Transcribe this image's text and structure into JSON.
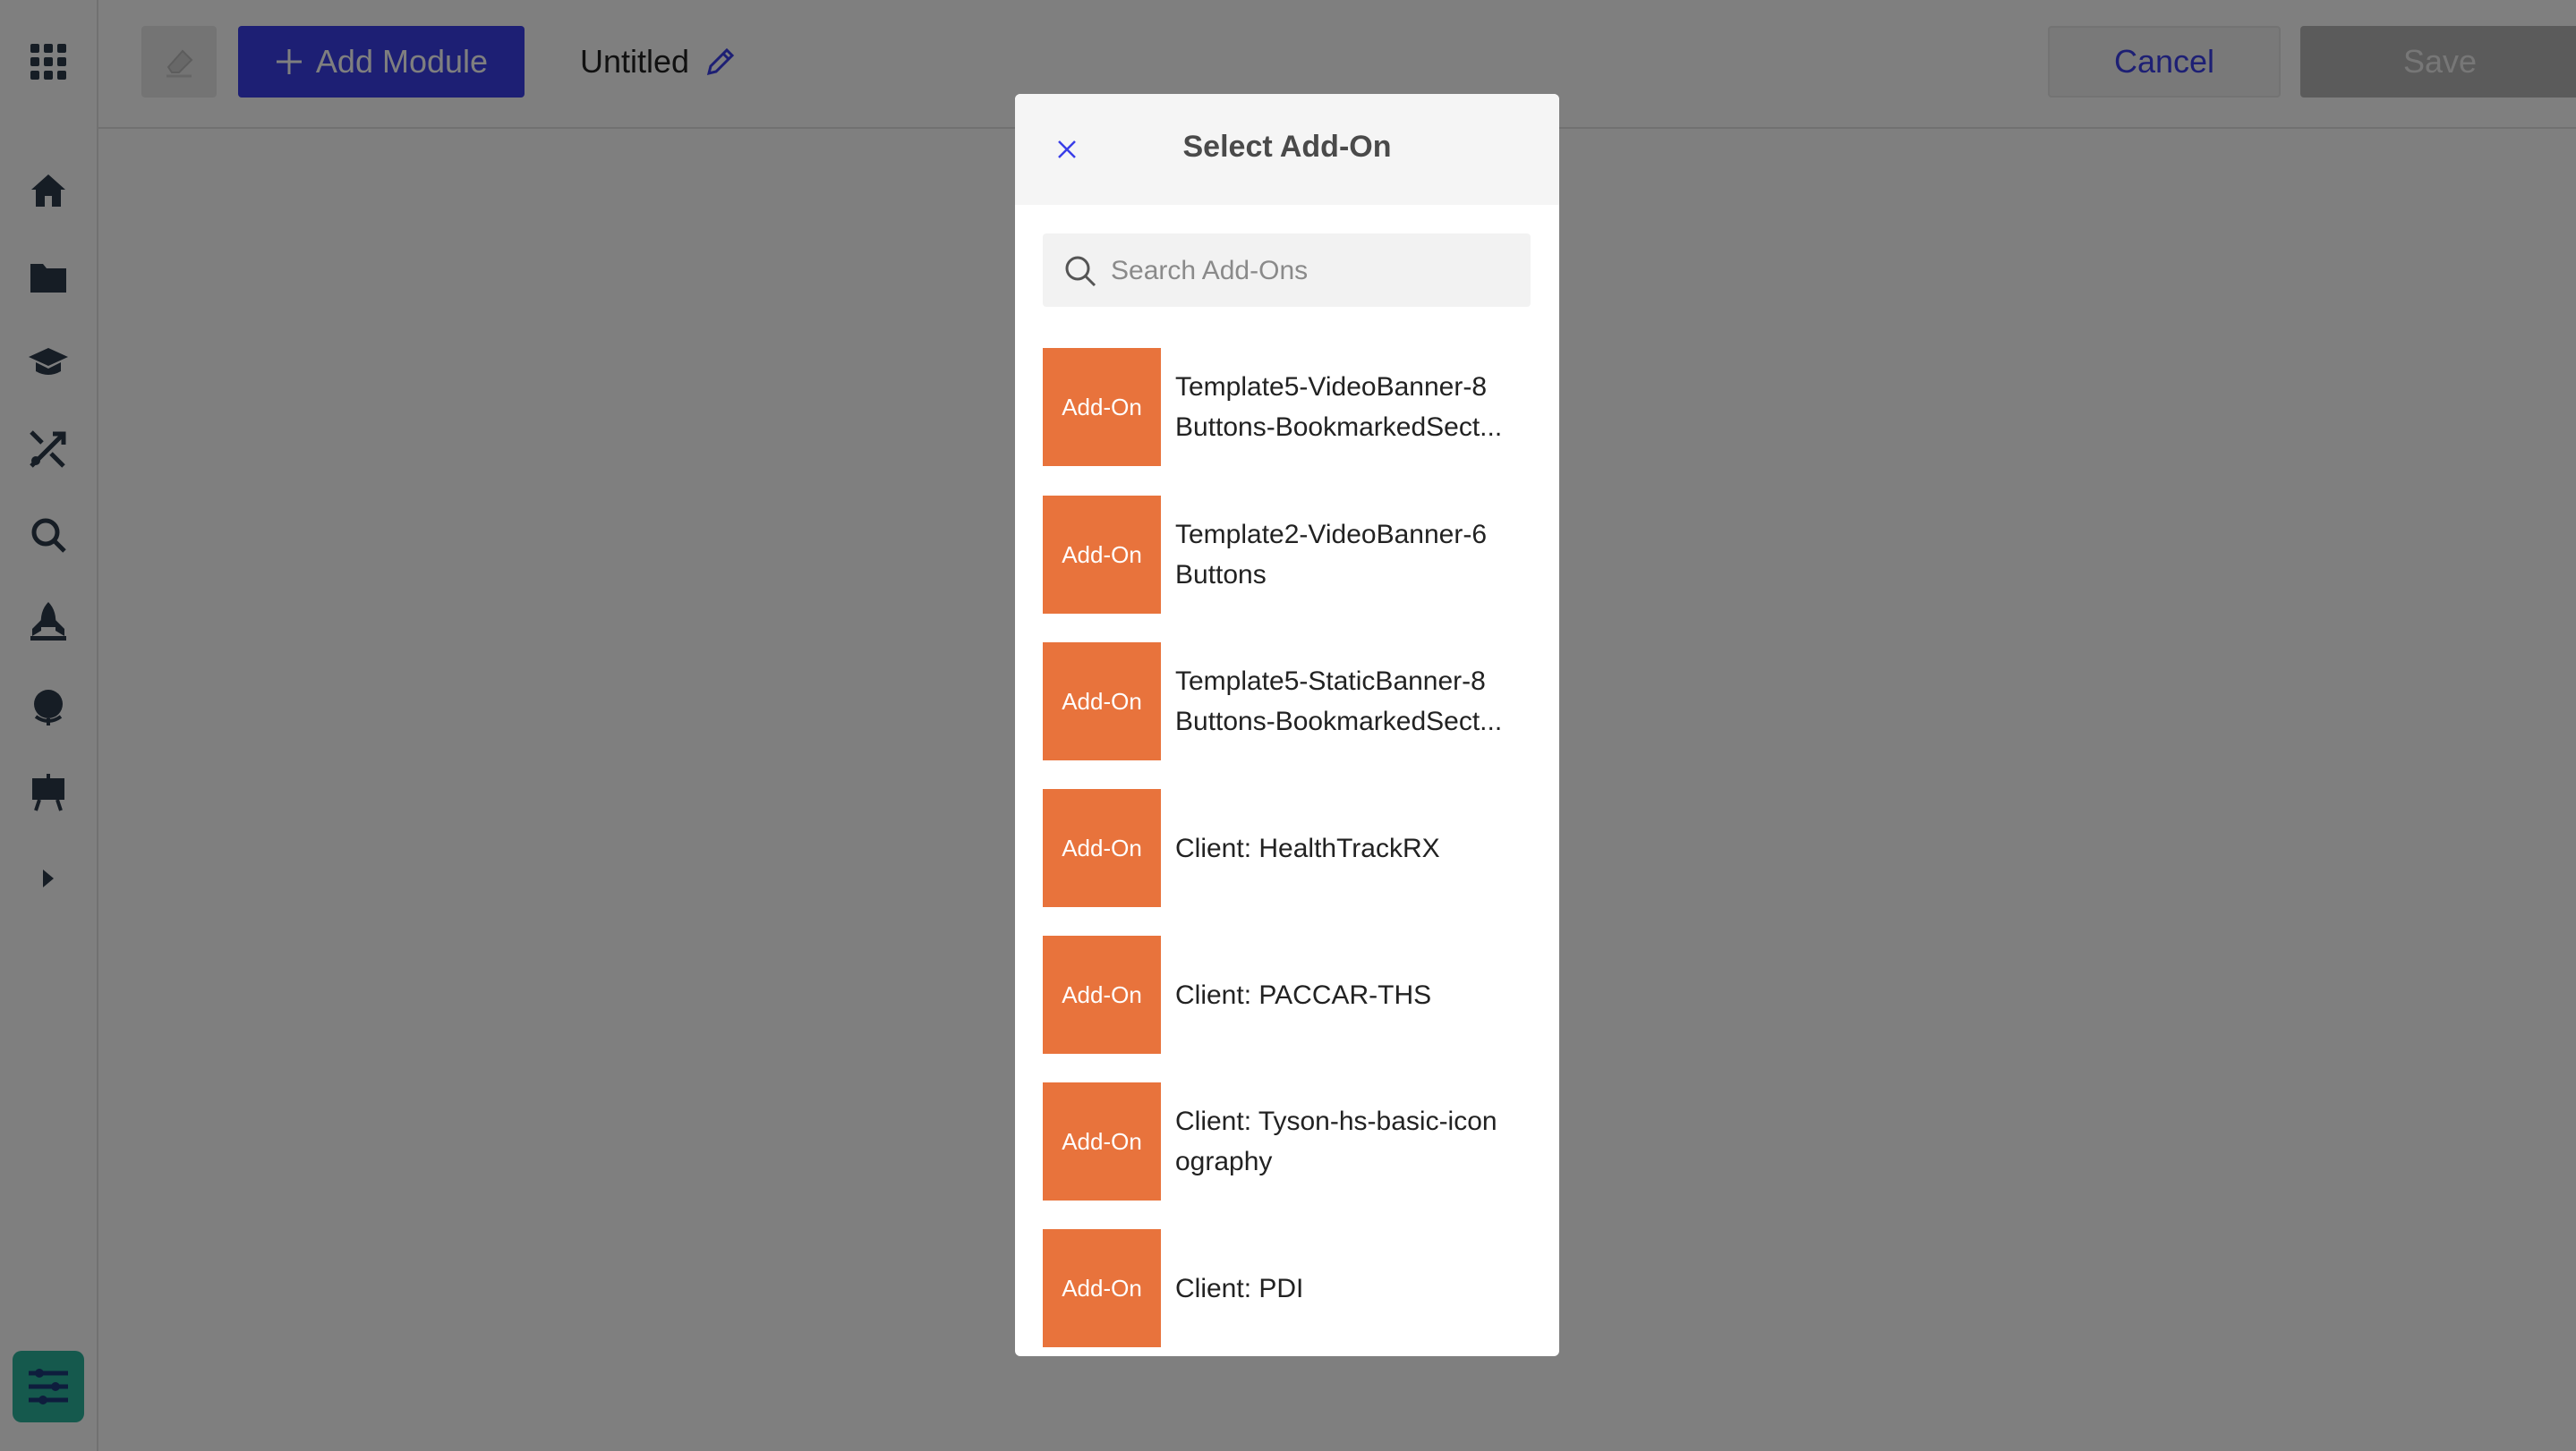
{
  "app": {
    "sidebar": {
      "icons": [
        "apps-grid-icon",
        "home-icon",
        "folder-icon",
        "graduation-cap-icon",
        "shuffle-icon",
        "search-icon",
        "rocket-icon",
        "globe-icon",
        "presentation-icon",
        "expand-arrow-icon"
      ],
      "bottom_icon": "sliders-icon"
    },
    "toolbar": {
      "eraser_icon": "eraser-icon",
      "add_module_label": "Add Module",
      "title": "Untitled",
      "cancel_label": "Cancel",
      "save_label": "Save"
    }
  },
  "modal": {
    "title": "Select Add-On",
    "search_placeholder": "Search Add-Ons",
    "thumb_label": "Add-On",
    "items": [
      {
        "line1": "Template5-VideoBanner-8",
        "line2": "Buttons-BookmarkedSect..."
      },
      {
        "line1": "Template2-VideoBanner-6",
        "line2": "Buttons"
      },
      {
        "line1": "Template5-StaticBanner-8",
        "line2": "Buttons-BookmarkedSect..."
      },
      {
        "line1": "Client: HealthTrackRX",
        "line2": ""
      },
      {
        "line1": "Client: PACCAR-THS",
        "line2": ""
      },
      {
        "line1": "Client: Tyson-hs-basic-icon",
        "line2": "ography"
      },
      {
        "line1": "Client: PDI",
        "line2": ""
      }
    ]
  },
  "colors": {
    "accent": "#3a3ee8",
    "addon_orange": "#e8733c",
    "sidebar_active": "#2bb39b"
  }
}
